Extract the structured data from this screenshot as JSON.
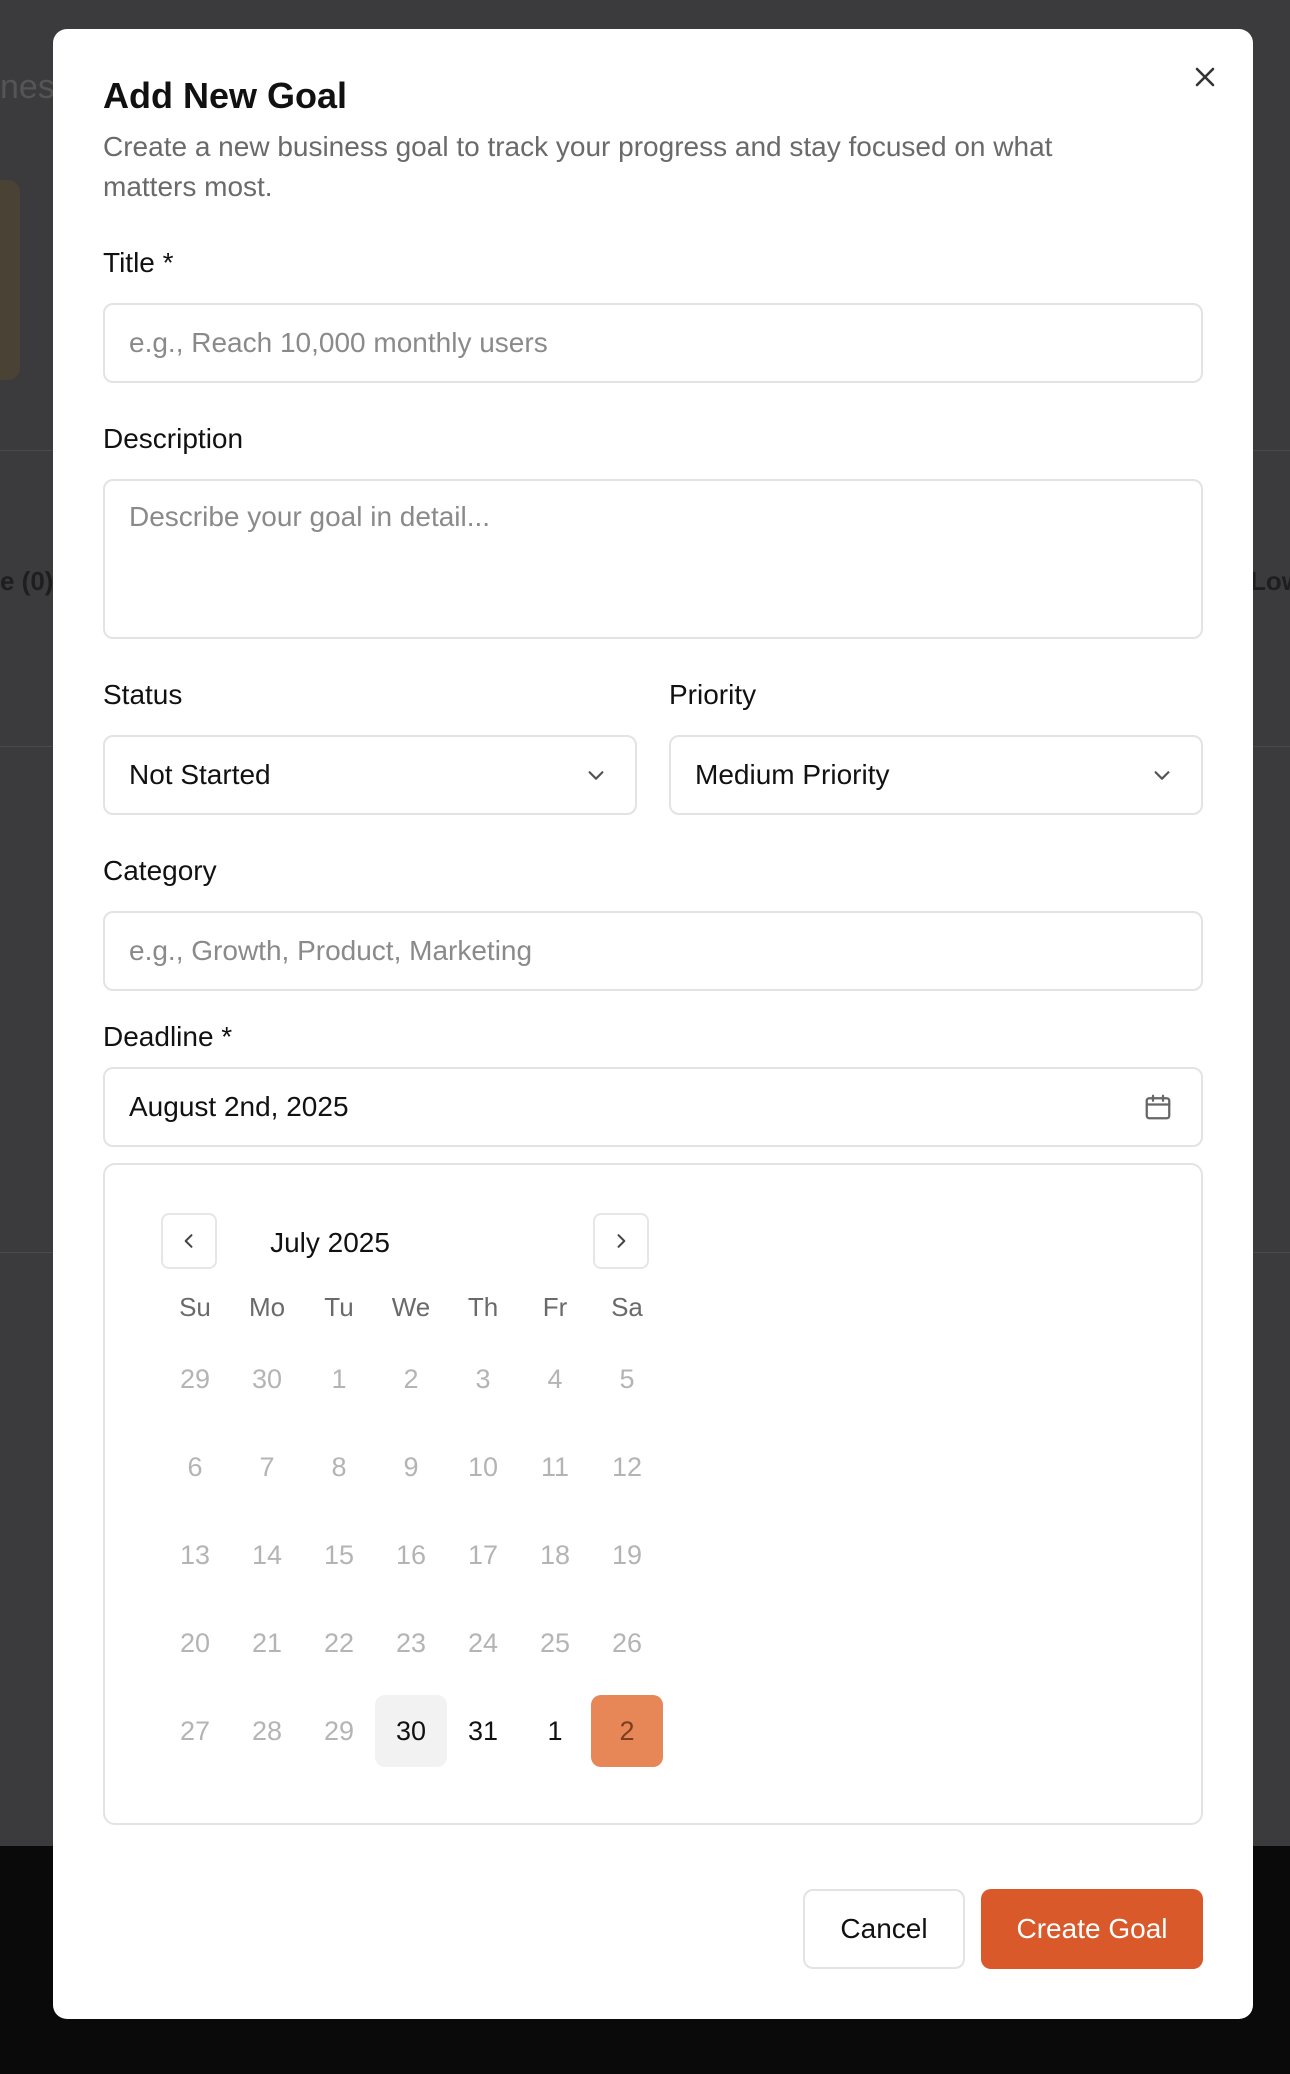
{
  "background": {
    "fragments": [
      "nes",
      "e (0)",
      "Low"
    ]
  },
  "modal": {
    "title": "Add New Goal",
    "description": "Create a new business goal to track your progress and stay focused on what matters most.",
    "close_icon": "close-icon",
    "fields": {
      "title": {
        "label": "Title *",
        "placeholder": "e.g., Reach 10,000 monthly users",
        "value": ""
      },
      "description": {
        "label": "Description",
        "placeholder": "Describe your goal in detail...",
        "value": ""
      },
      "status": {
        "label": "Status",
        "value": "Not Started"
      },
      "priority": {
        "label": "Priority",
        "value": "Medium Priority"
      },
      "category": {
        "label": "Category",
        "placeholder": "e.g., Growth, Product, Marketing",
        "value": ""
      },
      "deadline": {
        "label": "Deadline *",
        "value": "August 2nd, 2025"
      }
    },
    "calendar": {
      "month_label": "July 2025",
      "weekdays": [
        "Su",
        "Mo",
        "Tu",
        "We",
        "Th",
        "Fr",
        "Sa"
      ],
      "weeks": [
        [
          "29",
          "30",
          "1",
          "2",
          "3",
          "4",
          "5"
        ],
        [
          "6",
          "7",
          "8",
          "9",
          "10",
          "11",
          "12"
        ],
        [
          "13",
          "14",
          "15",
          "16",
          "17",
          "18",
          "19"
        ],
        [
          "20",
          "21",
          "22",
          "23",
          "24",
          "25",
          "26"
        ],
        [
          "27",
          "28",
          "29",
          "30",
          "31",
          "1",
          "2"
        ]
      ],
      "enabled_cells": [
        [
          4,
          3
        ],
        [
          4,
          4
        ],
        [
          4,
          5
        ],
        [
          4,
          6
        ]
      ],
      "today_cell": [
        4,
        3
      ],
      "selected_cell": [
        4,
        6
      ]
    },
    "buttons": {
      "cancel": "Cancel",
      "create": "Create Goal"
    }
  },
  "colors": {
    "accent": "#d9592b",
    "selected_day": "#e78758",
    "overlay": "#3b3b3d"
  }
}
